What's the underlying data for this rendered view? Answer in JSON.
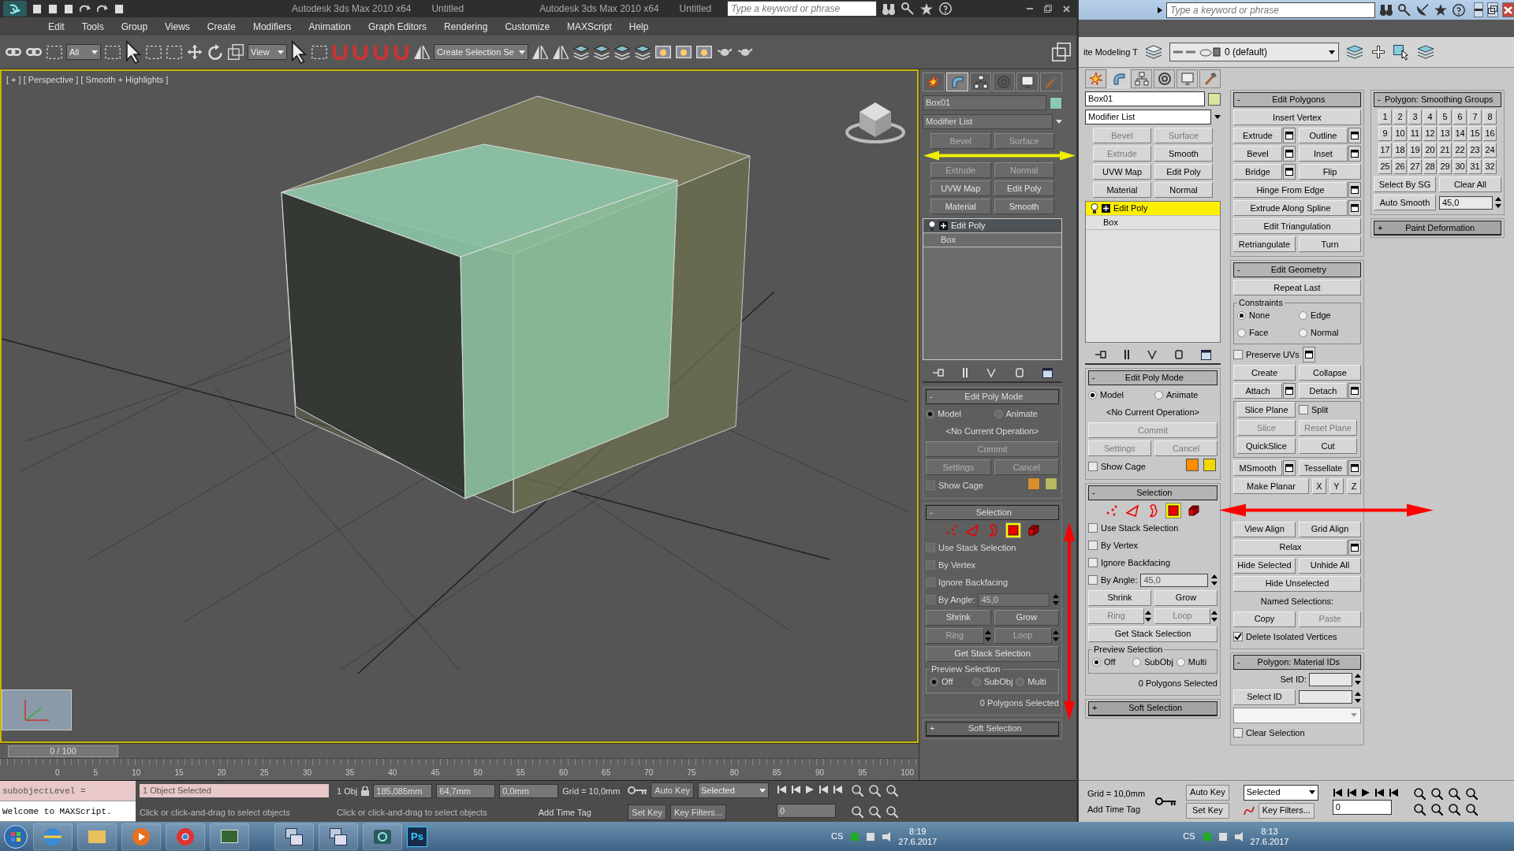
{
  "left_window": {
    "titles": [
      {
        "app": "Autodesk 3ds Max  2010 x64",
        "document": "Untitled"
      },
      {
        "app": "Autodesk 3ds Max  2010 x64",
        "document": "Untitled"
      }
    ],
    "search": {
      "placeholder": "Type a keyword or phrase"
    },
    "menu": [
      "Edit",
      "Tools",
      "Group",
      "Views",
      "Create",
      "Modifiers",
      "Animation",
      "Graph Editors",
      "Rendering",
      "Customize",
      "MAXScript",
      "Help"
    ],
    "toolbar": {
      "selection_filter": "All",
      "reference_coords": "View",
      "named_selection": "Create Selection Se"
    },
    "viewport": {
      "label": "[ + ] [ Perspective ] [ Smooth + Highlights ]"
    },
    "command_panel": {
      "tabs": [
        {
          "kind": "create",
          "selected": false
        },
        {
          "kind": "modify",
          "selected": true
        },
        {
          "kind": "hierarchy",
          "selected": false
        },
        {
          "kind": "motion",
          "selected": false
        },
        {
          "kind": "display",
          "selected": false
        },
        {
          "kind": "utilities",
          "selected": false
        }
      ],
      "object_name": "Box01",
      "modifier_list": "Modifier List",
      "modifier_buttons": [
        {
          "label": "Bevel",
          "disabled": true
        },
        {
          "label": "Surface",
          "disabled": true
        },
        {
          "label": "Extrude",
          "disabled": true
        },
        {
          "label": "Normal",
          "disabled": true
        },
        {
          "label": "UVW Map",
          "disabled": false
        },
        {
          "label": "Edit Poly",
          "disabled": false
        },
        {
          "label": "Material",
          "disabled": false
        },
        {
          "label": "Smooth",
          "disabled": false
        }
      ],
      "stack": [
        {
          "kind": "modifier",
          "label": "Edit Poly",
          "selected": true
        },
        {
          "kind": "base",
          "label": "Box",
          "selected": false
        }
      ],
      "rollouts": [
        {
          "sign": "-",
          "title": "Edit Poly Mode",
          "expanded": true,
          "rows": [
            [
              {
                "kind": "radio",
                "label": "Model",
                "selected": true
              },
              {
                "kind": "radio",
                "label": "Animate",
                "selected": false
              }
            ],
            [
              {
                "kind": "text",
                "text": "<No Current Operation>"
              }
            ],
            [
              {
                "kind": "button",
                "label": "Commit",
                "disabled": true
              }
            ],
            [
              {
                "kind": "button",
                "label": "Settings",
                "disabled": true
              },
              {
                "kind": "button",
                "label": "Cancel",
                "disabled": true
              }
            ],
            [
              {
                "kind": "check",
                "label": "Show Cage",
                "checked": false
              },
              {
                "kind": "swatch",
                "color": "#d89030"
              },
              {
                "kind": "swatch",
                "color": "#b8b860"
              }
            ]
          ]
        },
        {
          "sign": "-",
          "title": "Selection",
          "expanded": true,
          "rows": [
            [
              {
                "kind": "subobj",
                "items": [
                  {
                    "kind": "vertex",
                    "selected": false
                  },
                  {
                    "kind": "edge",
                    "selected": false
                  },
                  {
                    "kind": "border",
                    "selected": false
                  },
                  {
                    "kind": "polygon",
                    "selected": true
                  },
                  {
                    "kind": "element",
                    "selected": false
                  }
                ]
              }
            ],
            [
              {
                "kind": "check",
                "label": "Use Stack Selection",
                "checked": false
              }
            ],
            [
              {
                "kind": "check",
                "label": "By Vertex",
                "checked": false
              }
            ],
            [
              {
                "kind": "check",
                "label": "Ignore Backfacing",
                "checked": false
              }
            ],
            [
              {
                "kind": "check_spinner",
                "label": "By Angle:",
                "checked": false,
                "value": "45,0",
                "disabled": true
              }
            ],
            [
              {
                "kind": "button",
                "label": "Shrink",
                "disabled": false
              },
              {
                "kind": "button",
                "label": "Grow",
                "disabled": false
              }
            ],
            [
              {
                "kind": "spin_button",
                "label": "Ring",
                "disabled": true
              },
              {
                "kind": "spin_button",
                "label": "Loop",
                "disabled": true
              }
            ],
            [
              {
                "kind": "button",
                "label": "Get Stack Selection",
                "disabled": false
              }
            ],
            [
              {
                "kind": "group",
                "title": "Preview Selection",
                "rows": [
                  [
                    {
                      "kind": "radio",
                      "label": "Off",
                      "selected": true
                    },
                    {
                      "kind": "radio",
                      "label": "SubObj",
                      "selected": false
                    },
                    {
                      "kind": "radio",
                      "label": "Multi",
                      "selected": false
                    }
                  ]
                ]
              }
            ],
            [
              {
                "kind": "note",
                "text": "0 Polygons Selected"
              }
            ]
          ]
        },
        {
          "sign": "+",
          "title": "Soft Selection",
          "expanded": false
        }
      ]
    },
    "time_slider": "0 / 100",
    "ruler": [
      "0",
      "5",
      "10",
      "15",
      "20",
      "25",
      "30",
      "35",
      "40",
      "45",
      "50",
      "55",
      "60",
      "65",
      "70",
      "75",
      "80",
      "85",
      "90",
      "95",
      "100"
    ],
    "listener": [
      "subobjectLevel =",
      "Welcome to MAXScript."
    ],
    "status": {
      "selection": "1 Object Selected",
      "prompts": [
        "Click or click-and-drag to select objects",
        "Click or click-and-drag to select objects"
      ],
      "objects": "1 Obj",
      "x": "185,085mm",
      "y": "64,7mm",
      "z": "0,0mm",
      "grid": "Grid = 10,0mm",
      "add_time_tag": "Add Time Tag",
      "auto_key": "Auto Key",
      "key_mode": "Selected",
      "set_key": "Set Key",
      "key_filters": "Key Filters...",
      "frame": "0"
    }
  },
  "right_window": {
    "search": {
      "placeholder": "Type a keyword or phrase"
    },
    "toolbar": {
      "ribbon_label": "ite Modeling T",
      "layer": "0 (default)"
    },
    "command_panel": {
      "tabs": [
        {
          "kind": "create",
          "selected": false
        },
        {
          "kind": "modify",
          "selected": true
        },
        {
          "kind": "hierarchy",
          "selected": false
        },
        {
          "kind": "motion",
          "selected": false
        },
        {
          "kind": "display",
          "selected": false
        },
        {
          "kind": "utilities",
          "selected": false
        }
      ],
      "object_name": "Box01",
      "modifier_list": "Modifier List",
      "modifier_buttons": [
        {
          "label": "Bevel",
          "disabled": true
        },
        {
          "label": "Surface",
          "disabled": true
        },
        {
          "label": "Extrude",
          "disabled": true
        },
        {
          "label": "Smooth",
          "disabled": false
        },
        {
          "label": "UVW Map",
          "disabled": false
        },
        {
          "label": "Edit Poly",
          "disabled": false
        },
        {
          "label": "Material",
          "disabled": false
        },
        {
          "label": "Normal",
          "disabled": false
        }
      ],
      "stack": [
        {
          "kind": "modifier",
          "label": "Edit Poly",
          "selected": true
        },
        {
          "kind": "base",
          "label": "Box",
          "selected": false
        }
      ],
      "rollouts": [
        {
          "sign": "-",
          "title": "Edit Poly Mode",
          "expanded": true,
          "rows": [
            [
              {
                "kind": "radio",
                "label": "Model",
                "selected": true
              },
              {
                "kind": "radio",
                "label": "Animate",
                "selected": false
              }
            ],
            [
              {
                "kind": "text",
                "text": "<No Current Operation>"
              }
            ],
            [
              {
                "kind": "button",
                "label": "Commit",
                "disabled": true
              }
            ],
            [
              {
                "kind": "button",
                "label": "Settings",
                "disabled": true
              },
              {
                "kind": "button",
                "label": "Cancel",
                "disabled": true
              }
            ],
            [
              {
                "kind": "check",
                "label": "Show Cage",
                "checked": false
              },
              {
                "kind": "swatch",
                "color": "#ff8c00"
              },
              {
                "kind": "swatch",
                "color": "#f0d800"
              }
            ]
          ]
        },
        {
          "sign": "-",
          "title": "Selection",
          "expanded": true,
          "rows": [
            [
              {
                "kind": "subobj",
                "items": [
                  {
                    "kind": "vertex",
                    "selected": false
                  },
                  {
                    "kind": "edge",
                    "selected": false
                  },
                  {
                    "kind": "border",
                    "selected": false
                  },
                  {
                    "kind": "polygon",
                    "selected": true
                  },
                  {
                    "kind": "element",
                    "selected": false
                  }
                ]
              }
            ],
            [
              {
                "kind": "check",
                "label": "Use Stack Selection",
                "checked": false
              }
            ],
            [
              {
                "kind": "check",
                "label": "By Vertex",
                "checked": false
              }
            ],
            [
              {
                "kind": "check",
                "label": "Ignore Backfacing",
                "checked": false
              }
            ],
            [
              {
                "kind": "check_spinner",
                "label": "By Angle:",
                "checked": false,
                "value": "45,0",
                "disabled": true
              }
            ],
            [
              {
                "kind": "button",
                "label": "Shrink",
                "disabled": false
              },
              {
                "kind": "button",
                "label": "Grow",
                "disabled": false
              }
            ],
            [
              {
                "kind": "spin_button",
                "label": "Ring",
                "disabled": true
              },
              {
                "kind": "spin_button",
                "label": "Loop",
                "disabled": true
              }
            ],
            [
              {
                "kind": "button",
                "label": "Get Stack Selection",
                "disabled": false
              }
            ],
            [
              {
                "kind": "group",
                "title": "Preview Selection",
                "rows": [
                  [
                    {
                      "kind": "radio",
                      "label": "Off",
                      "selected": true
                    },
                    {
                      "kind": "radio",
                      "label": "SubObj",
                      "selected": false
                    },
                    {
                      "kind": "radio",
                      "label": "Multi",
                      "selected": false
                    }
                  ]
                ]
              }
            ],
            [
              {
                "kind": "note",
                "text": "0 Polygons Selected"
              }
            ]
          ]
        },
        {
          "sign": "+",
          "title": "Soft Selection",
          "expanded": false
        }
      ]
    },
    "columns": [
      [
        {
          "sign": "-",
          "title": "Edit Polygons",
          "expanded": true,
          "rows": [
            [
              {
                "kind": "button",
                "label": "Insert Vertex",
                "disabled": false
              }
            ],
            [
              {
                "kind": "button",
                "label": "Extrude",
                "disabled": false,
                "settings": true
              },
              {
                "kind": "button",
                "label": "Outline",
                "disabled": false,
                "settings": true
              }
            ],
            [
              {
                "kind": "button",
                "label": "Bevel",
                "disabled": false,
                "settings": true
              },
              {
                "kind": "button",
                "label": "Inset",
                "disabled": false,
                "settings": true
              }
            ],
            [
              {
                "kind": "button",
                "label": "Bridge",
                "disabled": false,
                "settings": true
              },
              {
                "kind": "button",
                "label": "Flip",
                "disabled": false
              }
            ],
            [
              {
                "kind": "button",
                "label": "Hinge From Edge",
                "disabled": false,
                "settings": true
              }
            ],
            [
              {
                "kind": "button",
                "label": "Extrude Along Spline",
                "disabled": false,
                "settings": true
              }
            ],
            [
              {
                "kind": "button",
                "label": "Edit Triangulation",
                "disabled": false
              }
            ],
            [
              {
                "kind": "button",
                "label": "Retriangulate",
                "disabled": false
              },
              {
                "kind": "button",
                "label": "Turn",
                "disabled": false
              }
            ]
          ]
        },
        {
          "sign": "-",
          "title": "Edit Geometry",
          "expanded": true,
          "rows": [
            [
              {
                "kind": "button",
                "label": "Repeat Last",
                "disabled": false
              }
            ],
            [
              {
                "kind": "group",
                "title": "Constraints",
                "rows": [
                  [
                    {
                      "kind": "radio",
                      "label": "None",
                      "selected": true
                    },
                    {
                      "kind": "radio",
                      "label": "Edge",
                      "selected": false
                    }
                  ],
                  [
                    {
                      "kind": "radio",
                      "label": "Face",
                      "selected": false
                    },
                    {
                      "kind": "radio",
                      "label": "Normal",
                      "selected": false
                    }
                  ]
                ]
              }
            ],
            [
              {
                "kind": "check",
                "label": "Preserve UVs",
                "checked": false,
                "settings": true
              }
            ],
            [
              {
                "kind": "button",
                "label": "Create",
                "disabled": false
              },
              {
                "kind": "button",
                "label": "Collapse",
                "disabled": false
              }
            ],
            [
              {
                "kind": "button",
                "label": "Attach",
                "disabled": false,
                "settings": true
              },
              {
                "kind": "button",
                "label": "Detach",
                "disabled": false,
                "settings": true
              }
            ],
            [
              {
                "kind": "group",
                "rows": [
                  [
                    {
                      "kind": "button",
                      "label": "Slice Plane",
                      "disabled": false
                    },
                    {
                      "kind": "check",
                      "label": "Split",
                      "checked": false
                    }
                  ],
                  [
                    {
                      "kind": "button",
                      "label": "Slice",
                      "disabled": true
                    },
                    {
                      "kind": "button",
                      "label": "Reset Plane",
                      "disabled": true
                    }
                  ],
                  [
                    {
                      "kind": "button",
                      "label": "QuickSlice",
                      "disabled": false
                    },
                    {
                      "kind": "button",
                      "label": "Cut",
                      "disabled": false
                    }
                  ]
                ]
              }
            ],
            [
              {
                "kind": "button",
                "label": "MSmooth",
                "disabled": false,
                "settings": true
              },
              {
                "kind": "button",
                "label": "Tessellate",
                "disabled": false,
                "settings": true
              }
            ],
            [
              {
                "kind": "button",
                "label": "Make Planar",
                "disabled": false
              },
              {
                "kind": "axis",
                "label": "X",
                "disabled": false
              },
              {
                "kind": "axis",
                "label": "Y",
                "disabled": false
              },
              {
                "kind": "axis",
                "label": "Z",
                "disabled": false
              }
            ],
            [
              {
                "kind": "button",
                "label": "View Align",
                "disabled": false
              },
              {
                "kind": "button",
                "label": "Grid Align",
                "disabled": false
              }
            ],
            [
              {
                "kind": "button",
                "label": "Relax",
                "disabled": false,
                "settings": true
              }
            ],
            [
              {
                "kind": "button",
                "label": "Hide Selected",
                "disabled": false
              },
              {
                "kind": "button",
                "label": "Unhide All",
                "disabled": false
              }
            ],
            [
              {
                "kind": "button",
                "label": "Hide Unselected",
                "disabled": false
              }
            ],
            [
              {
                "kind": "text",
                "text": "Named Selections:"
              }
            ],
            [
              {
                "kind": "button",
                "label": "Copy",
                "disabled": false
              },
              {
                "kind": "button",
                "label": "Paste",
                "disabled": true
              }
            ],
            [
              {
                "kind": "check",
                "label": "Delete Isolated Vertices",
                "checked": true
              }
            ]
          ]
        },
        {
          "sign": "-",
          "title": "Polygon: Material IDs",
          "expanded": true,
          "rows": [
            [
              {
                "kind": "spinner",
                "label": "Set ID:"
              }
            ],
            [
              {
                "kind": "button",
                "label": "Select ID",
                "disabled": false
              },
              {
                "kind": "spinner"
              }
            ],
            [
              {
                "kind": "dropdown"
              }
            ],
            [
              {
                "kind": "check",
                "label": "Clear Selection",
                "checked": false
              }
            ]
          ]
        }
      ],
      [
        {
          "sign": "-",
          "title": "Polygon: Smoothing Groups",
          "expanded": true,
          "rows": [
            [
              {
                "kind": "numgrid",
                "labels": [
                  "1",
                  "2",
                  "3",
                  "4",
                  "5",
                  "6",
                  "7",
                  "8",
                  "9",
                  "10",
                  "11",
                  "12",
                  "13",
                  "14",
                  "15",
                  "16",
                  "17",
                  "18",
                  "19",
                  "20",
                  "21",
                  "22",
                  "23",
                  "24",
                  "25",
                  "26",
                  "27",
                  "28",
                  "29",
                  "30",
                  "31",
                  "32"
                ]
              }
            ],
            [
              {
                "kind": "button",
                "label": "Select By SG",
                "disabled": false
              },
              {
                "kind": "button",
                "label": "Clear All",
                "disabled": false
              }
            ],
            [
              {
                "kind": "button",
                "label": "Auto Smooth",
                "disabled": false
              },
              {
                "kind": "spinner",
                "value": "45,0",
                "disabled": false
              }
            ]
          ]
        },
        {
          "sign": "+",
          "title": "Paint Deformation",
          "expanded": false
        }
      ]
    ],
    "status": {
      "grid": "Grid = 10,0mm",
      "add_time_tag": "Add Time Tag",
      "auto_key": "Auto Key",
      "key_mode": "Selected",
      "set_key": "Set Key",
      "key_filters": "Key Filters...",
      "frame": "0"
    }
  },
  "taskbar": {
    "photoshop": "Ps",
    "trays": [
      {
        "language": "CS",
        "time": "8:19",
        "date": "27.6.2017"
      },
      {
        "language": "CS",
        "time": "8:13",
        "date": "27.6.2017"
      }
    ]
  }
}
